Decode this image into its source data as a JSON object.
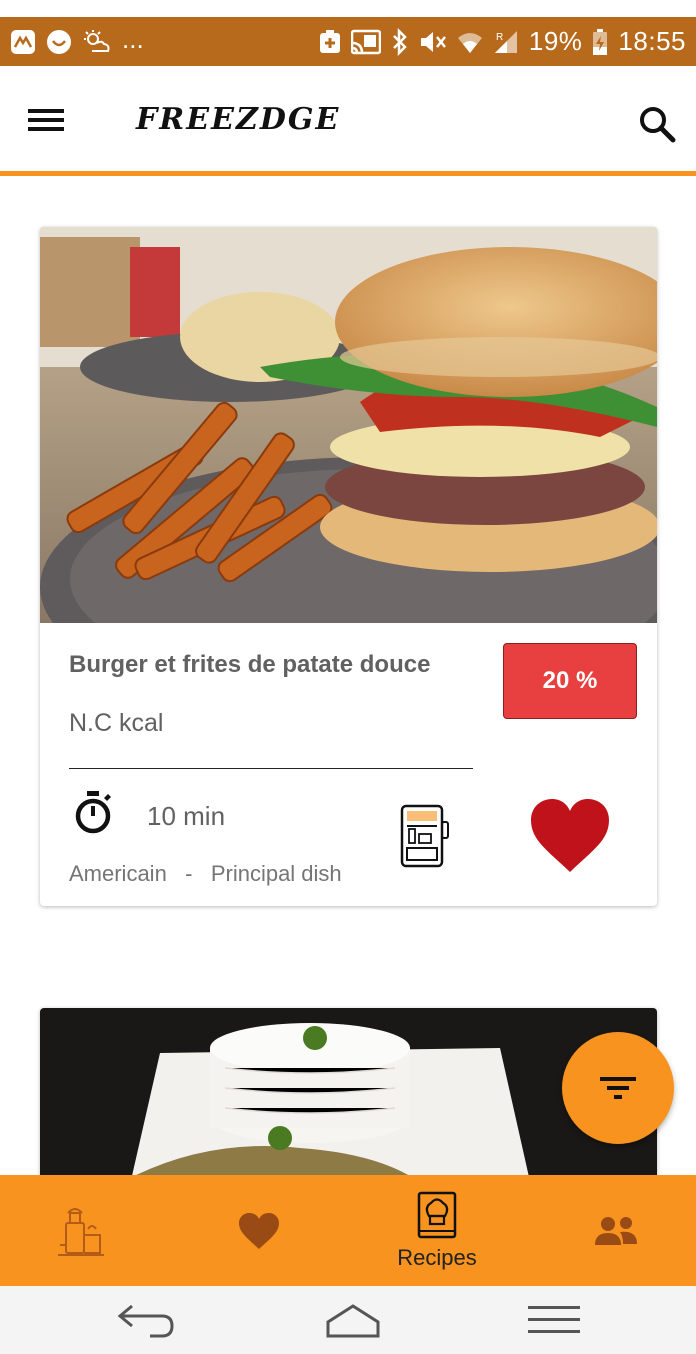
{
  "status_bar": {
    "battery_percent": "19%",
    "time": "18:55",
    "overflow_dots": "...",
    "background_color": "#b86a1c"
  },
  "app_bar": {
    "title": "FREEZDGE",
    "accent_color": "#f7931e"
  },
  "recipes": [
    {
      "title": "Burger et frites de patate douce",
      "kcal": "N.C kcal",
      "match": "20 %",
      "time": "10 min",
      "cuisine": "Americain",
      "separator": "-",
      "category": "Principal dish",
      "favorite": true,
      "image": "burger-and-sweet-potato-fries-photo"
    },
    {
      "image": "rice-and-chicken-curry-photo"
    }
  ],
  "bottom_nav": {
    "items": [
      {
        "icon": "fridge-icon",
        "label": ""
      },
      {
        "icon": "heart-icon",
        "label": ""
      },
      {
        "icon": "recipe-book-icon",
        "label": "Recipes",
        "active": true
      },
      {
        "icon": "people-icon",
        "label": ""
      }
    ]
  },
  "colors": {
    "primary": "#f7931e",
    "badge": "#e84040",
    "heart": "#c0121b"
  }
}
